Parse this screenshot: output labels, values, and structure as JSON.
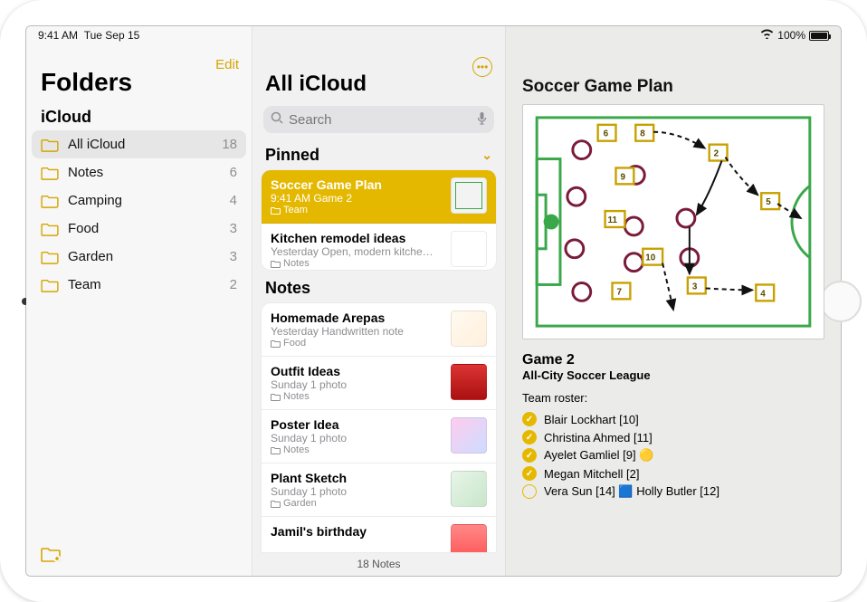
{
  "status": {
    "time": "9:41 AM",
    "date": "Tue Sep 15",
    "battery": "100%"
  },
  "folders": {
    "edit": "Edit",
    "title": "Folders",
    "section": "iCloud",
    "items": [
      {
        "name": "All iCloud",
        "count": "18",
        "selected": true
      },
      {
        "name": "Notes",
        "count": "6"
      },
      {
        "name": "Camping",
        "count": "4"
      },
      {
        "name": "Food",
        "count": "3"
      },
      {
        "name": "Garden",
        "count": "3"
      },
      {
        "name": "Team",
        "count": "2"
      }
    ]
  },
  "list": {
    "title": "All iCloud",
    "search_placeholder": "Search",
    "pinned_label": "Pinned",
    "notes_label": "Notes",
    "footer": "18 Notes",
    "pinned": [
      {
        "title": "Soccer Game Plan",
        "sub": "9:41 AM  Game 2",
        "folder": "Team",
        "selected": true
      },
      {
        "title": "Kitchen remodel ideas",
        "sub": "Yesterday  Open, modern kitche…",
        "folder": "Notes"
      }
    ],
    "notes": [
      {
        "title": "Homemade Arepas",
        "sub": "Yesterday  Handwritten note",
        "folder": "Food"
      },
      {
        "title": "Outfit Ideas",
        "sub": "Sunday  1 photo",
        "folder": "Notes"
      },
      {
        "title": "Poster Idea",
        "sub": "Sunday  1 photo",
        "folder": "Notes"
      },
      {
        "title": "Plant Sketch",
        "sub": "Sunday  1 photo",
        "folder": "Garden"
      },
      {
        "title": "Jamil's birthday",
        "sub": "",
        "folder": ""
      }
    ]
  },
  "note": {
    "title": "Soccer Game Plan",
    "subtitle": "Game 2",
    "subtitle2": "All-City Soccer League",
    "roster_label": "Team roster:",
    "roster": [
      {
        "name": "Blair Lockhart [10]",
        "checked": true
      },
      {
        "name": "Christina Ahmed [11]",
        "checked": true
      },
      {
        "name": "Ayelet Gamliel [9] 🟡",
        "checked": true
      },
      {
        "name": "Megan Mitchell [2]",
        "checked": true
      },
      {
        "name": "Vera Sun [14] 🟦 Holly Butler [12]",
        "checked": false
      }
    ]
  }
}
